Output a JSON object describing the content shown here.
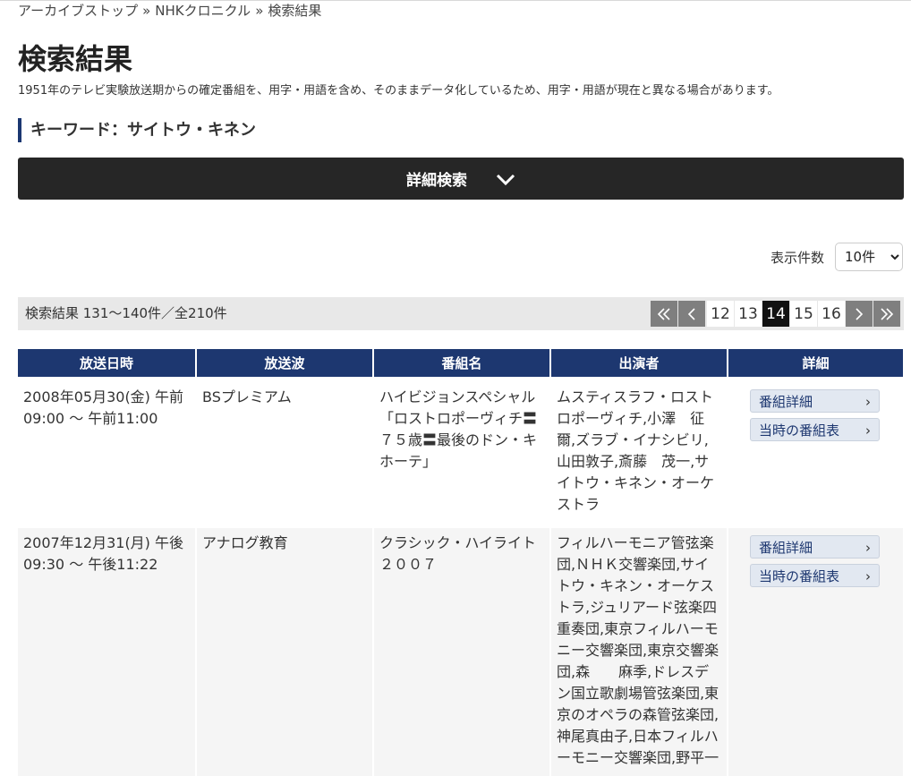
{
  "breadcrumb": {
    "items": [
      "アーカイブストップ",
      "NHKクロニクル",
      "検索結果"
    ],
    "separator": "»"
  },
  "page": {
    "title": "検索結果",
    "note": "1951年のテレビ実験放送期からの確定番組を、用字・用語を含め、そのままデータ化しているため、用字・用語が現在と異なる場合があります。"
  },
  "keyword": {
    "label": "キーワード：サイトウ・キネン"
  },
  "detail_search": {
    "label": "詳細検索",
    "icon": "chevron-down-icon"
  },
  "per_page": {
    "label": "表示件数",
    "value": "10件"
  },
  "results_summary": {
    "text": "検索結果 131〜140件／全210件"
  },
  "pagination": {
    "first_icon": "double-chevron-left-icon",
    "prev_icon": "chevron-left-icon",
    "pages": [
      "12",
      "13",
      "14",
      "15",
      "16"
    ],
    "current": "14",
    "next_icon": "chevron-right-icon",
    "last_icon": "double-chevron-right-icon"
  },
  "table": {
    "headers": [
      "放送日時",
      "放送波",
      "番組名",
      "出演者",
      "詳細"
    ],
    "rows": [
      {
        "datetime": "2008年05月30(金) 午前09:00 〜 午前11:00",
        "channel": "BSプレミアム",
        "program": "ハイビジョンスペシャル「ロストロポーヴィチ〓７５歳〓最後のドン・キホーテ」",
        "performers": "ムスティスラフ・ロストロポーヴィチ,小澤　征爾,ズラブ・イナシビリ,山田敦子,斎藤　茂一,サイトウ・キネン・オーケストラ",
        "detail_button": "番組詳細",
        "schedule_button": "当時の番組表"
      },
      {
        "datetime": "2007年12月31(月) 午後09:30 〜 午後11:22",
        "channel": "アナログ教育",
        "program": "クラシック・ハイライト２００７",
        "performers": "フィルハーモニア管弦楽団,ＮＨＫ交響楽団,サイトウ・キネン・オーケストラ,ジュリアード弦楽四重奏団,東京フィルハーモニー交響楽団,東京交響楽団,森　　麻季,ドレスデン国立歌劇場管弦楽団,東京のオペラの森管弦楽団,神尾真由子,日本フィルハーモニー交響楽団,野平一",
        "detail_button": "番組詳細",
        "schedule_button": "当時の番組表"
      }
    ]
  }
}
